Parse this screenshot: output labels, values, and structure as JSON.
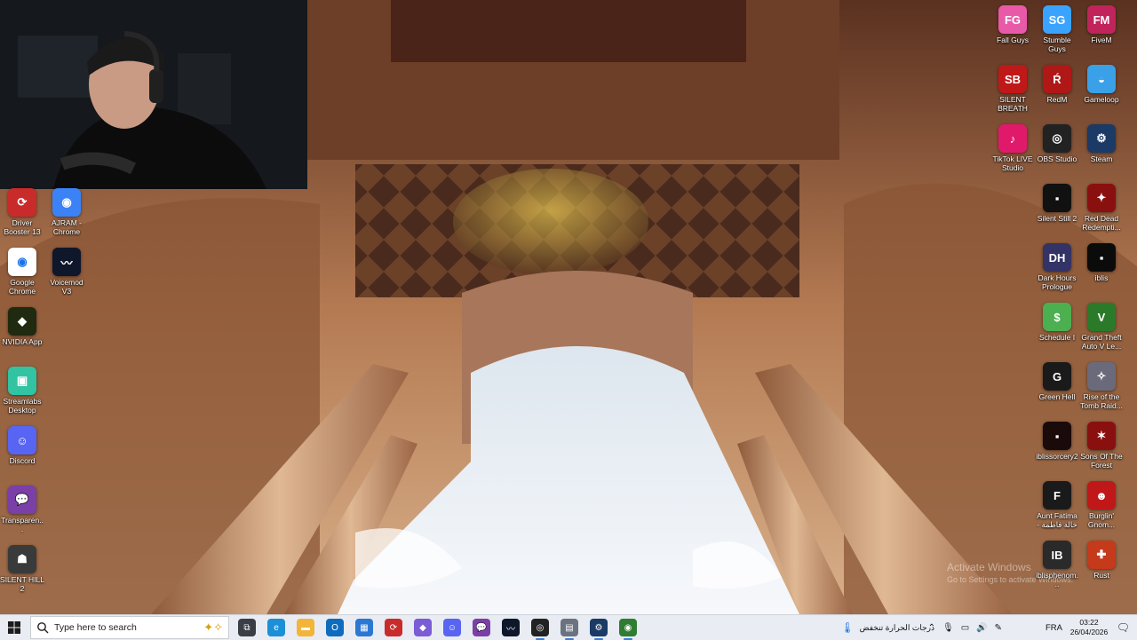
{
  "desktop": {
    "left_icons": [
      {
        "label": "Driver Booster 13",
        "color": "#c92b2b",
        "glyph": "⟳",
        "icon": "driver-booster-icon"
      },
      {
        "label": "AJRAM - Chrome",
        "color": "#3b82f6",
        "glyph": "◉",
        "icon": "chrome-profile-icon"
      },
      {
        "label": "Google Chrome",
        "color": "#ffffff",
        "glyph": "◉",
        "icon": "chrome-icon"
      },
      {
        "label": "Voicemod V3",
        "color": "#0f172a",
        "glyph": "〰",
        "icon": "voicemod-icon"
      },
      {
        "label": "NVIDIA App",
        "color": "#1f2a10",
        "glyph": "◆",
        "icon": "nvidia-icon"
      },
      {
        "label": "Streamlabs Desktop",
        "color": "#31c3a2",
        "glyph": "▣",
        "icon": "streamlabs-icon"
      },
      {
        "label": "Discord",
        "color": "#5865f2",
        "glyph": "☺",
        "icon": "discord-icon"
      },
      {
        "label": "Transparen...",
        "color": "#7b3fa8",
        "glyph": "💬",
        "icon": "chat-bubble-icon"
      },
      {
        "label": "SILENT HILL 2",
        "color": "#3a3a3a",
        "glyph": "☗",
        "icon": "silent-hill-icon"
      }
    ],
    "right_icons": [
      {
        "label": "Fall Guys",
        "color": "#e85aa8",
        "glyph": "FG",
        "icon": "fall-guys-icon"
      },
      {
        "label": "Stumble Guys",
        "color": "#3aa3ff",
        "glyph": "SG",
        "icon": "stumble-guys-icon"
      },
      {
        "label": "FiveM",
        "color": "#c0245a",
        "glyph": "FM",
        "icon": "fivem-icon"
      },
      {
        "label": "SILENT BREATH",
        "color": "#c01818",
        "glyph": "SB",
        "icon": "silent-breath-icon"
      },
      {
        "label": "RedM",
        "color": "#b01818",
        "glyph": "Ŕ",
        "icon": "redm-icon"
      },
      {
        "label": "Gameloop",
        "color": "#3aa0e8",
        "glyph": "◒",
        "icon": "gameloop-icon"
      },
      {
        "label": "TikTok LIVE Studio",
        "color": "#e1196a",
        "glyph": "♪",
        "icon": "tiktok-icon"
      },
      {
        "label": "OBS Studio",
        "color": "#222",
        "glyph": "◎",
        "icon": "obs-icon"
      },
      {
        "label": "Steam",
        "color": "#1b3a66",
        "glyph": "⚙",
        "icon": "steam-icon"
      },
      {
        "label": "Silent Still 2",
        "color": "#111",
        "glyph": "▪",
        "icon": "silent-still-icon"
      },
      {
        "label": "Red Dead Redempti...",
        "color": "#8a1010",
        "glyph": "✦",
        "icon": "red-dead-icon"
      },
      {
        "label": "Dark Hours Prologue",
        "color": "#333366",
        "glyph": "DH",
        "icon": "dark-hours-icon"
      },
      {
        "label": "iblis",
        "color": "#0b0b0b",
        "glyph": "▪",
        "icon": "iblis-icon"
      },
      {
        "label": "Schedule I",
        "color": "#4caf50",
        "glyph": "$",
        "icon": "schedule-icon"
      },
      {
        "label": "Grand Theft Auto V Le...",
        "color": "#2a7a2a",
        "glyph": "V",
        "icon": "gta-icon"
      },
      {
        "label": "Green Hell",
        "color": "#1a1a1a",
        "glyph": "G",
        "icon": "green-hell-icon"
      },
      {
        "label": "Rise of the Tomb Raid...",
        "color": "#6a6a7a",
        "glyph": "✧",
        "icon": "tomb-raider-icon"
      },
      {
        "label": "iblissorcery2",
        "color": "#1a0a0a",
        "glyph": "▪",
        "icon": "iblissorcery-icon"
      },
      {
        "label": "Sons Of The Forest",
        "color": "#8a1010",
        "glyph": "✶",
        "icon": "sons-forest-icon"
      },
      {
        "label": "Aunt Fatima - خالة فاطمة",
        "color": "#1a1a1a",
        "glyph": "F",
        "icon": "aunt-fatima-icon"
      },
      {
        "label": "Burglin' Gnom...",
        "color": "#c01818",
        "glyph": "☻",
        "icon": "burglin-gnomes-icon"
      },
      {
        "label": "iblisphenom...",
        "color": "#2a2a2a",
        "glyph": "IB",
        "icon": "iblisphenom-icon"
      },
      {
        "label": "Rust",
        "color": "#c43a1a",
        "glyph": "✚",
        "icon": "rust-icon"
      }
    ],
    "watermark": {
      "title": "Activate Windows",
      "subtitle": "Go to Settings to activate Windows."
    }
  },
  "taskbar": {
    "search_placeholder": "Type here to search",
    "apps": [
      {
        "name": "task-view-button",
        "glyph": "⧉",
        "color": "#3a3f47"
      },
      {
        "name": "edge-button",
        "glyph": "e",
        "color": "#1c8fd6"
      },
      {
        "name": "file-explorer-button",
        "glyph": "▬",
        "color": "#f2b53a"
      },
      {
        "name": "outlook-button",
        "glyph": "O",
        "color": "#0f6cbd"
      },
      {
        "name": "store-button",
        "glyph": "▦",
        "color": "#2b78d4"
      },
      {
        "name": "driver-booster-button",
        "glyph": "⟳",
        "color": "#c92b2b"
      },
      {
        "name": "visual-studio-button",
        "glyph": "◆",
        "color": "#7a5cd6"
      },
      {
        "name": "discord-button",
        "glyph": "☺",
        "color": "#5865f2"
      },
      {
        "name": "chat-app-button",
        "glyph": "💬",
        "color": "#7b3fa8"
      },
      {
        "name": "voicemod-button",
        "glyph": "〰",
        "color": "#0f172a"
      },
      {
        "name": "obs-button",
        "glyph": "◎",
        "color": "#222"
      },
      {
        "name": "notepad-button",
        "glyph": "▤",
        "color": "#6b7280"
      },
      {
        "name": "steam-button",
        "glyph": "⚙",
        "color": "#1b3a66"
      },
      {
        "name": "chrome-button",
        "glyph": "◉",
        "color": "#2e7d32"
      }
    ],
    "weather_text": "درجات الحرارة تنخفض",
    "language": "FRA",
    "time": "03:22",
    "date": "26/04/2026"
  }
}
